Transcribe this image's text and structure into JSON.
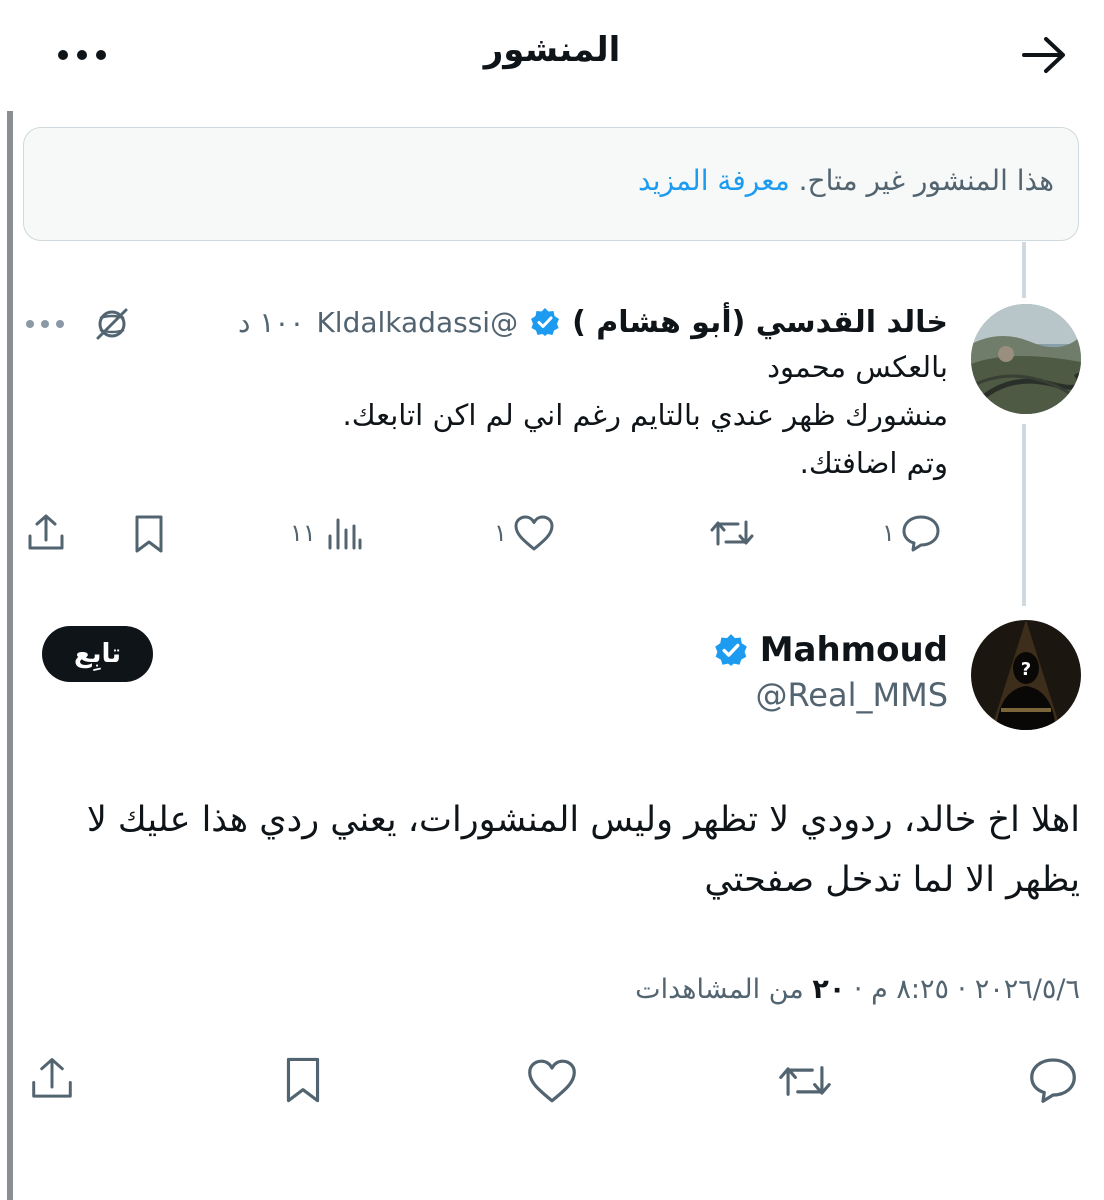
{
  "header": {
    "title": "المنشور"
  },
  "unavailable": {
    "text": "هذا المنشور غير متاح.",
    "link": "معرفة المزيد"
  },
  "reply_tweet": {
    "author_name": "خالد القدسي (أبو هشام )",
    "handle": "@Kldalkadassi",
    "time": "١٠٠ د",
    "lines": [
      "بالعكس محمود",
      "منشورك ظهر عندي بالتايم رغم اني لم اكن اتابعك.",
      "وتم اضافتك."
    ],
    "actions": {
      "replies": "١",
      "reposts": "",
      "likes": "١",
      "views": "١١"
    }
  },
  "main_tweet": {
    "author_name": "Mahmoud",
    "handle": "@Real_MMS",
    "follow_label": "تابِع",
    "text": "اهلا اخ خالد، ردودي لا تظهر وليس المنشورات، يعني ردي هذا عليك لا يظهر الا لما تدخل صفحتي",
    "date": "٢٠٢٦/٥/٦",
    "time": "٨:٢٥ م",
    "views_count": "٢٠",
    "views_label": "من المشاهدات"
  },
  "colors": {
    "accent": "#1d9bf0",
    "text": "#0f1419",
    "muted": "#536471",
    "verified": "#1d9bf0"
  },
  "icons": [
    "arrow-right-icon",
    "more-icon",
    "verified-badge-icon",
    "globe-off-icon",
    "reply-icon",
    "repost-icon",
    "like-icon",
    "views-icon",
    "bookmark-icon",
    "share-icon"
  ]
}
